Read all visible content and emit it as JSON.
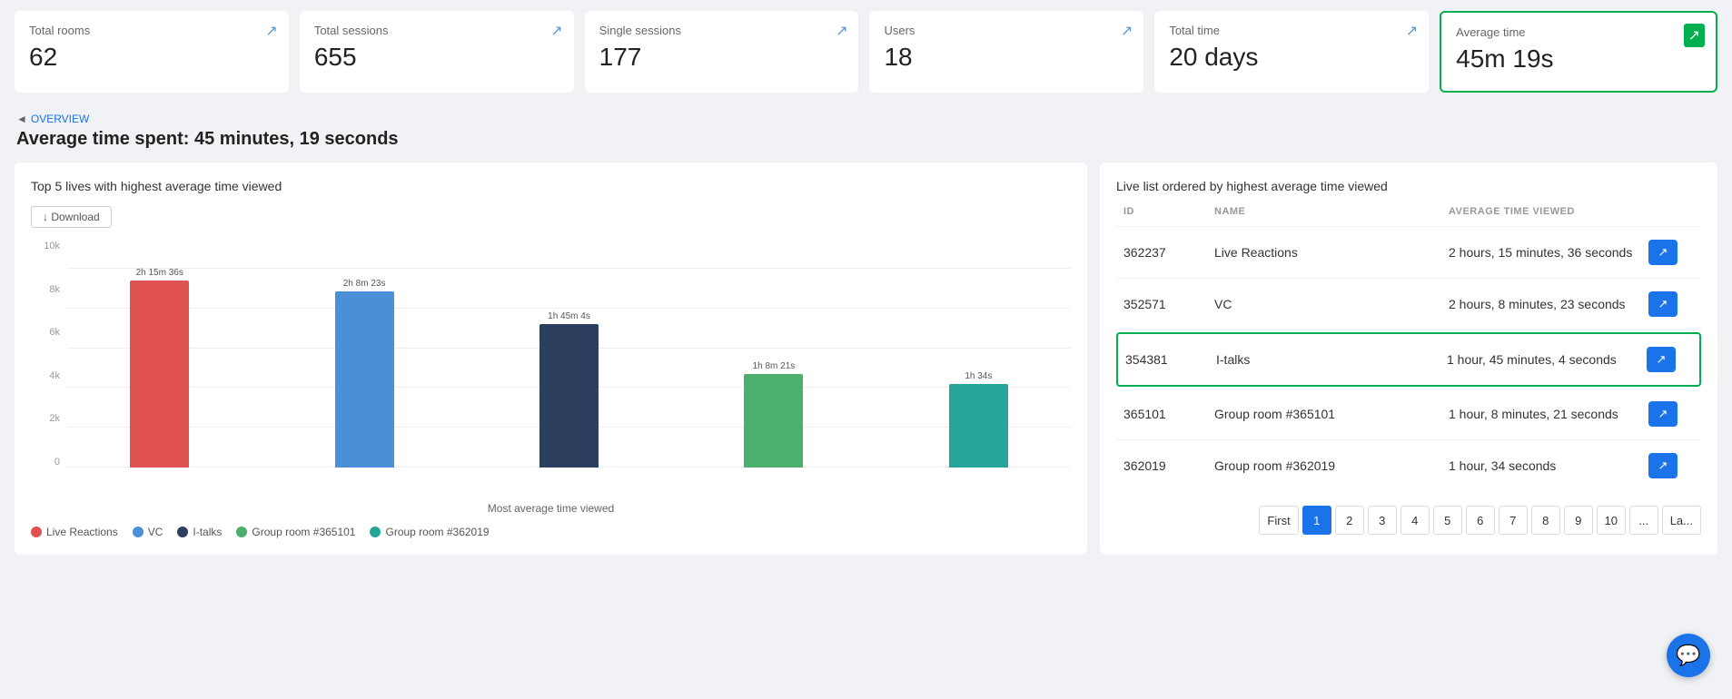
{
  "stats": [
    {
      "label": "Total rooms",
      "value": "62",
      "highlighted": false
    },
    {
      "label": "Total sessions",
      "value": "655",
      "highlighted": false
    },
    {
      "label": "Single sessions",
      "value": "177",
      "highlighted": false
    },
    {
      "label": "Users",
      "value": "18",
      "highlighted": false
    },
    {
      "label": "Total time",
      "value": "20 days",
      "highlighted": false
    },
    {
      "label": "Average time",
      "value": "45m 19s",
      "highlighted": true
    }
  ],
  "breadcrumb": {
    "parent": "OVERVIEW",
    "arrow": "◄"
  },
  "page_title": "Average time spent: 45 minutes, 19 seconds",
  "chart": {
    "title": "Top 5 lives with highest average time viewed",
    "download_label": "↓ Download",
    "x_axis_label": "Most average time viewed",
    "y_labels": [
      "0",
      "2k",
      "4k",
      "6k",
      "8k",
      "10k"
    ],
    "bars": [
      {
        "label": "2h 15m 36s",
        "color": "#e05252",
        "height_pct": 95,
        "name": "Live Reactions"
      },
      {
        "label": "2h 8m 23s",
        "color": "#4a90d9",
        "height_pct": 88,
        "name": "VC"
      },
      {
        "label": "1h 45m 4s",
        "color": "#2d3f5e",
        "height_pct": 72,
        "name": "I-talks"
      },
      {
        "label": "1h 8m 21s",
        "color": "#4caf6e",
        "height_pct": 47,
        "name": "Group room #365101"
      },
      {
        "label": "1h 34s",
        "color": "#26a69a",
        "height_pct": 42,
        "name": "Group room #362019"
      }
    ],
    "legend": [
      {
        "color": "#e05252",
        "label": "Live Reactions"
      },
      {
        "color": "#4a90d9",
        "label": "VC"
      },
      {
        "color": "#2d3f5e",
        "label": "I-talks"
      },
      {
        "color": "#4caf6e",
        "label": "Group room #365101"
      },
      {
        "color": "#26a69a",
        "label": "Group room #362019"
      }
    ]
  },
  "table": {
    "title": "Live list ordered by highest average time viewed",
    "columns": [
      "ID",
      "NAME",
      "AVERAGE TIME VIEWED",
      ""
    ],
    "rows": [
      {
        "id": "362237",
        "name": "Live Reactions",
        "avg_time": "2 hours, 15 minutes, 36 seconds",
        "highlighted": false
      },
      {
        "id": "352571",
        "name": "VC",
        "avg_time": "2 hours, 8 minutes, 23 seconds",
        "highlighted": false
      },
      {
        "id": "354381",
        "name": "I-talks",
        "avg_time": "1 hour, 45 minutes, 4 seconds",
        "highlighted": true
      },
      {
        "id": "365101",
        "name": "Group room #365101",
        "avg_time": "1 hour, 8 minutes, 21 seconds",
        "highlighted": false
      },
      {
        "id": "362019",
        "name": "Group room #362019",
        "avg_time": "1 hour, 34 seconds",
        "highlighted": false
      }
    ],
    "pagination": {
      "first_label": "First",
      "last_label": "La...",
      "ellipsis": "...",
      "pages": [
        "1",
        "2",
        "3",
        "4",
        "5",
        "6",
        "7",
        "8",
        "9",
        "10"
      ],
      "active_page": "1"
    }
  },
  "open_icon": "↗",
  "chat_icon": "💬"
}
